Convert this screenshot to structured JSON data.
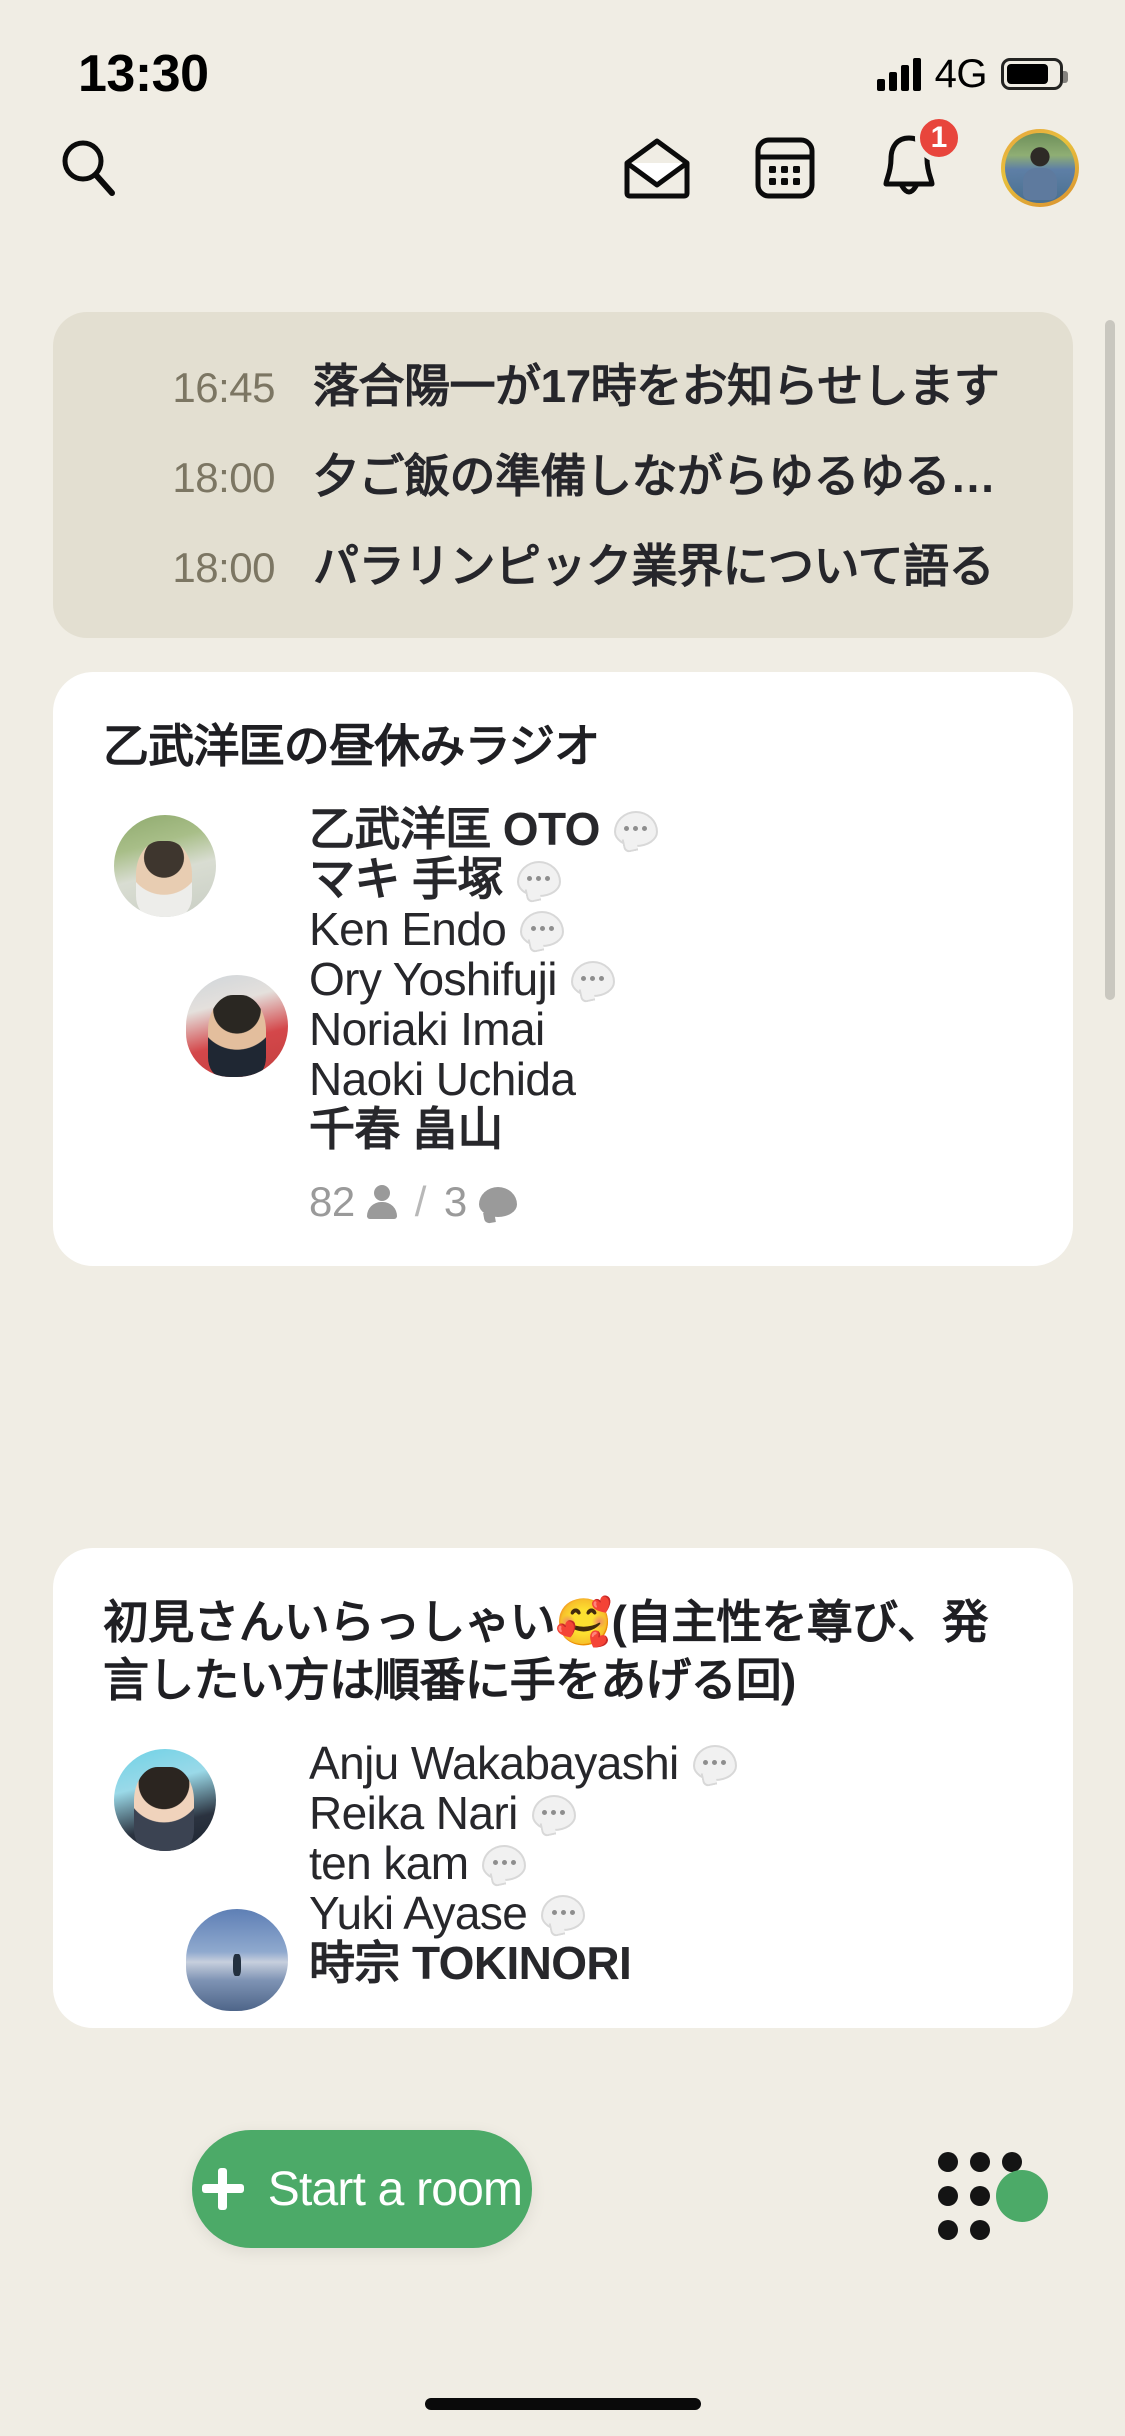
{
  "status_bar": {
    "time": "13:30",
    "network": "4G",
    "signal_icon": "signal-bars-icon",
    "battery_icon": "battery-icon"
  },
  "navbar": {
    "search_icon": "search-icon",
    "mail_icon": "envelope-open-icon",
    "calendar_icon": "calendar-icon",
    "bell_icon": "bell-icon",
    "bell_badge": "1",
    "avatar_icon": "profile-avatar"
  },
  "schedule": {
    "rows": [
      {
        "time": "16:45",
        "title": "落合陽一が17時をお知らせします"
      },
      {
        "time": "18:00",
        "title": "夕ご飯の準備しながらゆるゆる…"
      },
      {
        "time": "18:00",
        "title": "パラリンピック業界について語る"
      }
    ]
  },
  "rooms": [
    {
      "title": "乙武洋匡の昼休みラジオ",
      "speakers": [
        {
          "name": "乙武洋匡 OTO",
          "jp": true,
          "speaking": true
        },
        {
          "name": "マキ 手塚",
          "jp": true,
          "speaking": true
        },
        {
          "name": "Ken Endo",
          "jp": false,
          "speaking": true
        },
        {
          "name": "Ory Yoshifuji",
          "jp": false,
          "speaking": true
        },
        {
          "name": "Noriaki Imai",
          "jp": false,
          "speaking": false
        },
        {
          "name": "Naoki Uchida",
          "jp": false,
          "speaking": false
        },
        {
          "name": "千春 畠山",
          "jp": true,
          "speaking": false
        }
      ],
      "member_count": "82",
      "separator": "/",
      "speaker_count": "3"
    },
    {
      "title": "初見さんいらっしゃい🥰(自主性を尊び、発言したい方は順番に手をあげる回)",
      "speakers": [
        {
          "name": "Anju Wakabayashi",
          "jp": false,
          "speaking": true
        },
        {
          "name": "Reika Nari",
          "jp": false,
          "speaking": true
        },
        {
          "name": "ten kam",
          "jp": false,
          "speaking": true
        },
        {
          "name": "Yuki Ayase",
          "jp": false,
          "speaking": true
        },
        {
          "name": "時宗 TOKINORI",
          "jp": true,
          "speaking": false
        }
      ]
    }
  ],
  "bottom_bar": {
    "start_room_label": "Start a room",
    "plus_icon": "plus-icon",
    "grid_icon": "people-grid-icon"
  },
  "colors": {
    "background": "#F0EDE4",
    "card": "#FFFFFF",
    "schedule_card": "#E3DFD1",
    "accent_green": "#4CAA68",
    "badge_red": "#E8453C",
    "time_text": "#7C7663"
  }
}
